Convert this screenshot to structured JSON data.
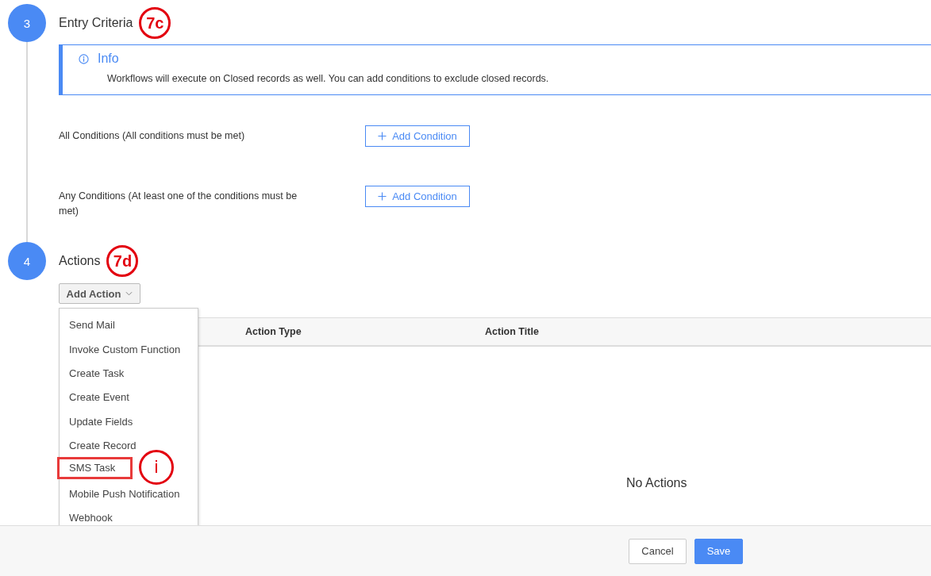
{
  "sections": [
    {
      "step": "3",
      "title": "Entry Criteria",
      "annotation": "7c",
      "kind": "criteria",
      "info": {
        "title": "Info",
        "message": "Workflows will execute on Closed records as well. You can add conditions to exclude closed records."
      },
      "conditions": [
        {
          "label": "All Conditions (All conditions must be met)",
          "button": "Add Condition"
        },
        {
          "label": "Any Conditions (At least one of the conditions must be met)",
          "button": "Add Condition"
        }
      ]
    },
    {
      "step": "4",
      "title": "Actions",
      "annotation": "7d",
      "kind": "actions",
      "add_action": {
        "label": "Add Action",
        "expanded": true,
        "menu": [
          {
            "label": "Send Mail",
            "highlighted": false
          },
          {
            "label": "Invoke Custom Function",
            "highlighted": false
          },
          {
            "label": "Create Task",
            "highlighted": false
          },
          {
            "label": "Create Event",
            "highlighted": false
          },
          {
            "label": "Update Fields",
            "highlighted": false
          },
          {
            "label": "Create Record",
            "highlighted": false
          },
          {
            "label": "SMS Task",
            "highlighted": true,
            "annotation": "i"
          },
          {
            "label": "Mobile Push Notification",
            "highlighted": false
          },
          {
            "label": "Webhook",
            "highlighted": false
          }
        ]
      },
      "table": {
        "columns": [
          "Action Type",
          "Action Title"
        ],
        "empty_text": "No Actions"
      }
    }
  ],
  "footer": {
    "buttons": [
      {
        "label": "Cancel",
        "kind": "secondary"
      },
      {
        "label": "Save",
        "kind": "primary"
      }
    ]
  }
}
